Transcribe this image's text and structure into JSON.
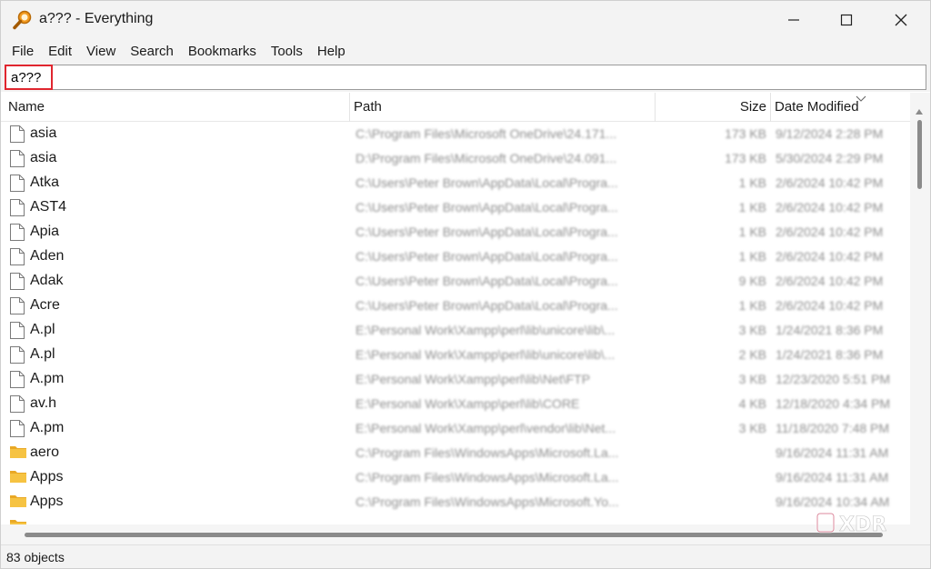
{
  "window": {
    "title": "a??? - Everything"
  },
  "menu": [
    "File",
    "Edit",
    "View",
    "Search",
    "Bookmarks",
    "Tools",
    "Help"
  ],
  "search": {
    "value": "a???"
  },
  "columns": {
    "name": "Name",
    "path": "Path",
    "size": "Size",
    "date": "Date Modified"
  },
  "rows": [
    {
      "name": "asia",
      "type": "file",
      "path": "C:\\Program Files\\Microsoft OneDrive\\24.171...",
      "size": "173 KB",
      "date": "9/12/2024 2:28 PM"
    },
    {
      "name": "asia",
      "type": "file",
      "path": "D:\\Program Files\\Microsoft OneDrive\\24.091...",
      "size": "173 KB",
      "date": "5/30/2024 2:29 PM"
    },
    {
      "name": "Atka",
      "type": "file",
      "path": "C:\\Users\\Peter Brown\\AppData\\Local\\Progra...",
      "size": "1 KB",
      "date": "2/6/2024 10:42 PM"
    },
    {
      "name": "AST4",
      "type": "file",
      "path": "C:\\Users\\Peter Brown\\AppData\\Local\\Progra...",
      "size": "1 KB",
      "date": "2/6/2024 10:42 PM"
    },
    {
      "name": "Apia",
      "type": "file",
      "path": "C:\\Users\\Peter Brown\\AppData\\Local\\Progra...",
      "size": "1 KB",
      "date": "2/6/2024 10:42 PM"
    },
    {
      "name": "Aden",
      "type": "file",
      "path": "C:\\Users\\Peter Brown\\AppData\\Local\\Progra...",
      "size": "1 KB",
      "date": "2/6/2024 10:42 PM"
    },
    {
      "name": "Adak",
      "type": "file",
      "path": "C:\\Users\\Peter Brown\\AppData\\Local\\Progra...",
      "size": "9 KB",
      "date": "2/6/2024 10:42 PM"
    },
    {
      "name": "Acre",
      "type": "file",
      "path": "C:\\Users\\Peter Brown\\AppData\\Local\\Progra...",
      "size": "1 KB",
      "date": "2/6/2024 10:42 PM"
    },
    {
      "name": "A.pl",
      "type": "file",
      "path": "E:\\Personal Work\\Xampp\\perl\\lib\\unicore\\lib\\...",
      "size": "3 KB",
      "date": "1/24/2021 8:36 PM"
    },
    {
      "name": "A.pl",
      "type": "file",
      "path": "E:\\Personal Work\\Xampp\\perl\\lib\\unicore\\lib\\...",
      "size": "2 KB",
      "date": "1/24/2021 8:36 PM"
    },
    {
      "name": "A.pm",
      "type": "file",
      "path": "E:\\Personal Work\\Xampp\\perl\\lib\\Net\\FTP",
      "size": "3 KB",
      "date": "12/23/2020 5:51 PM"
    },
    {
      "name": "av.h",
      "type": "file",
      "path": "E:\\Personal Work\\Xampp\\perl\\lib\\CORE",
      "size": "4 KB",
      "date": "12/18/2020 4:34 PM"
    },
    {
      "name": "A.pm",
      "type": "file",
      "path": "E:\\Personal Work\\Xampp\\perl\\vendor\\lib\\Net...",
      "size": "3 KB",
      "date": "11/18/2020 7:48 PM"
    },
    {
      "name": "aero",
      "type": "folder",
      "path": "C:\\Program Files\\WindowsApps\\Microsoft.La...",
      "size": "",
      "date": "9/16/2024 11:31 AM"
    },
    {
      "name": "Apps",
      "type": "folder",
      "path": "C:\\Program Files\\WindowsApps\\Microsoft.La...",
      "size": "",
      "date": "9/16/2024 11:31 AM"
    },
    {
      "name": "Apps",
      "type": "folder",
      "path": "C:\\Program Files\\WindowsApps\\Microsoft.Yo...",
      "size": "",
      "date": "9/16/2024 10:34 AM"
    },
    {
      "name": "",
      "type": "folder",
      "path": "",
      "size": "",
      "date": ""
    }
  ],
  "status": {
    "text": "83 objects"
  },
  "watermark": {
    "text": "XDR"
  },
  "colors": {
    "highlight": "#e0262f",
    "folder": "#f6c342",
    "chrome": "#f3f3f3"
  }
}
